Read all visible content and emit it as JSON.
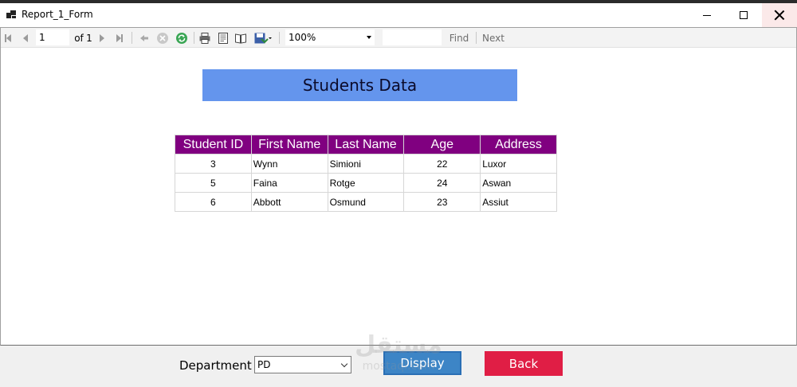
{
  "window": {
    "title": "Report_1_Form"
  },
  "toolbar": {
    "current_page": "1",
    "of_label": "of",
    "total_pages": "1",
    "zoom": "100%",
    "find_label": "Find",
    "next_label": "Next"
  },
  "report": {
    "title": "Students Data",
    "columns": [
      "Student ID",
      "First Name",
      "Last Name",
      "Age",
      "Address"
    ],
    "rows": [
      [
        "3",
        "Wynn",
        "Simioni",
        "22",
        "Luxor"
      ],
      [
        "5",
        "Faina",
        "Rotge",
        "24",
        "Aswan"
      ],
      [
        "6",
        "Abbott",
        "Osmund",
        "23",
        "Assiut"
      ]
    ]
  },
  "form": {
    "department_label": "Department",
    "department_value": "PD",
    "display_label": "Display",
    "back_label": "Back"
  },
  "watermark": {
    "arabic": "مستقل",
    "latin": "mostaql.com"
  },
  "colors": {
    "title_bg": "#6495ed",
    "header_bg": "#800080",
    "display_button": "#3d85c6",
    "back_button": "#e01e45"
  }
}
